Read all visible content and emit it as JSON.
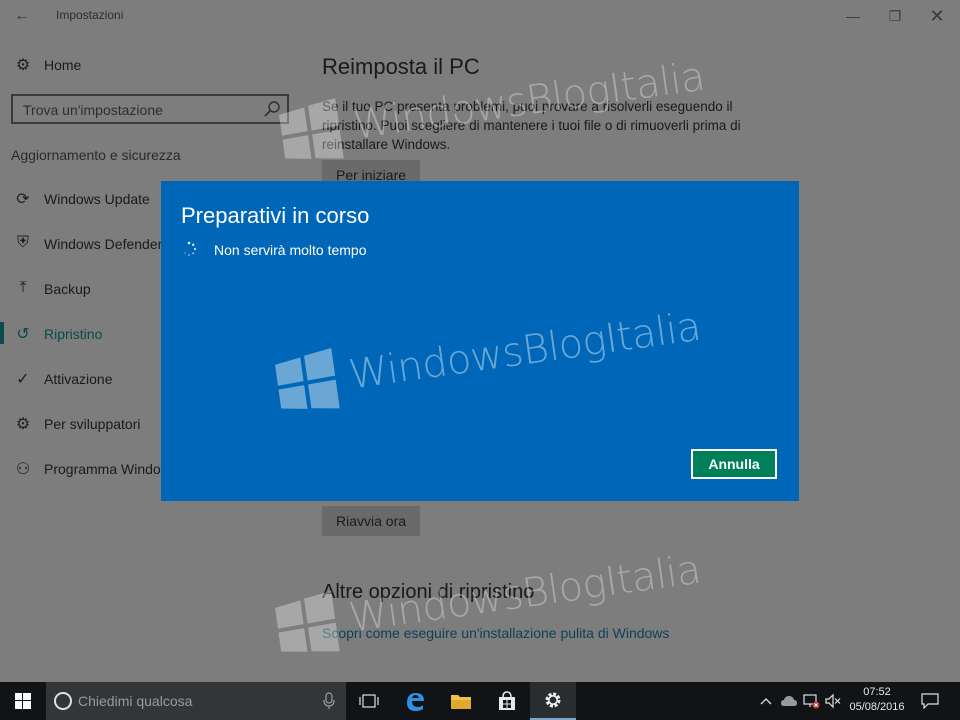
{
  "window": {
    "title": "Impostazioni",
    "back_glyph": "←",
    "minimize_glyph": "—",
    "maximize_glyph": "❐",
    "close_glyph": "✕"
  },
  "sidebar": {
    "home": {
      "label": "Home",
      "icon": "gear-icon"
    },
    "search_placeholder": "Trova un'impostazione",
    "section_title": "Aggiornamento e sicurezza",
    "items": [
      {
        "label": "Windows Update",
        "icon": "sync-icon",
        "glyph": "⟳",
        "active": false
      },
      {
        "label": "Windows Defender",
        "icon": "shield-icon",
        "glyph": "⛨",
        "active": false
      },
      {
        "label": "Backup",
        "icon": "upload-arrow-icon",
        "glyph": "⤒",
        "active": false
      },
      {
        "label": "Ripristino",
        "icon": "history-icon",
        "glyph": "↺",
        "active": true
      },
      {
        "label": "Attivazione",
        "icon": "checkmark-circle-icon",
        "glyph": "✓",
        "active": false
      },
      {
        "label": "Per sviluppatori",
        "icon": "developer-tools-icon",
        "glyph": "⚙",
        "active": false
      },
      {
        "label": "Programma Windows Insider",
        "icon": "person-icon",
        "glyph": "⚇",
        "active": false
      }
    ]
  },
  "main": {
    "heading": "Reimposta il PC",
    "description": "Se il tuo PC presenta problemi, puoi provare a risolverli eseguendo il ripristino. Puoi scegliere di mantenere i tuoi file o di rimuoverli prima di reinstallare Windows.",
    "start_button": "Per iniziare",
    "restart_button": "Riavvia ora",
    "other_heading": "Altre opzioni di ripristino",
    "clean_install_link": "Scopri come eseguire un'installazione pulita di Windows"
  },
  "dialog": {
    "title": "Preparativi in corso",
    "message": "Non servirà molto tempo",
    "cancel_button": "Annulla"
  },
  "watermark": {
    "text": "WindowsBlogItalia"
  },
  "taskbar": {
    "search_placeholder": "Chiedimi qualcosa",
    "apps": [
      "task-view-icon",
      "edge-icon",
      "file-explorer-icon",
      "store-icon",
      "settings-icon"
    ],
    "time": "07:52",
    "date": "05/08/2016"
  },
  "colors": {
    "dialog_bg": "#0067b8",
    "cancel_button": "#00805a",
    "accent_active": "#0a4a4a",
    "taskbar": "#101417"
  }
}
